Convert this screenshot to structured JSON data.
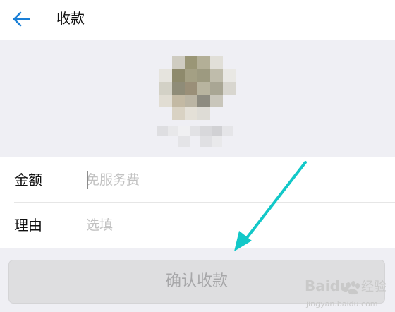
{
  "header": {
    "title": "收款"
  },
  "recipient": {
    "avatar_colors": [
      "#efeff4",
      "#cfccc1",
      "#9a9676",
      "#b3af97",
      "#e1dfd8",
      "#efeff4",
      "#e6e4de",
      "#8e8a6c",
      "#a4a084",
      "#9d9a80",
      "#bfbcab",
      "#e9e8e4",
      "#d3d1c6",
      "#8f8c78",
      "#9a8f78",
      "#b8b49f",
      "#a9a694",
      "#d8d6cf",
      "#e1ddd3",
      "#c3b9a3",
      "#bbb5a4",
      "#8d8b80",
      "#c9c6bb",
      "#efeff4",
      "#efeff4",
      "#d9d2c3",
      "#e4e0d7",
      "#dedcd6",
      "#efeff4",
      "#efeff4"
    ],
    "name_colors": [
      "#dedee1",
      "#e8e8ea",
      "#f0f0f2",
      "#e2e2e5",
      "#d8d8db",
      "#d1d1d4",
      "#e5e5e8",
      "#efeff4",
      "#efeff4",
      "#efeff4",
      "#e4e4e7",
      "#efeff4",
      "#e0e0e3",
      "#e9e9eb",
      "#efeff4",
      "#efeff4"
    ]
  },
  "form": {
    "amount": {
      "label": "金额",
      "placeholder": "免服务费",
      "value": ""
    },
    "reason": {
      "label": "理由",
      "placeholder": "选填",
      "value": ""
    }
  },
  "confirm_button": {
    "label": "确认收款"
  },
  "colors": {
    "accent_blue": "#1a7fd6",
    "annotation_arrow": "#12c8c8",
    "button_disabled_bg": "#dedee0",
    "button_disabled_text": "#a7a7a9",
    "page_bg": "#efeff4"
  },
  "watermark": {
    "brand": "Baidu",
    "product": "经验",
    "url": "jingyan.baidu.com"
  },
  "icons": {
    "back": "arrow-left-icon",
    "annotation": "pointer-arrow-icon",
    "watermark_paw": "paw-icon"
  }
}
